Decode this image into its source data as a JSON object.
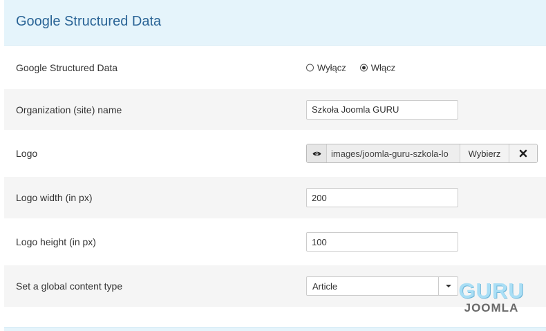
{
  "panel": {
    "title": "Google Structured Data"
  },
  "rows": {
    "enable": {
      "label": "Google Structured Data",
      "options": [
        "Wyłącz",
        "Włącz"
      ],
      "selected": "Włącz"
    },
    "org_name": {
      "label": "Organization (site) name",
      "value": "Szkoła Joomla GURU"
    },
    "logo": {
      "label": "Logo",
      "preview_icon": "eye-icon",
      "path": "images/joomla-guru-szkola-lo",
      "select_label": "Wybierz",
      "clear_icon": "close-icon"
    },
    "logo_width": {
      "label": "Logo width (in px)",
      "value": "200"
    },
    "logo_height": {
      "label": "Logo height (in px)",
      "value": "100"
    },
    "content_type": {
      "label": "Set a global content type",
      "value": "Article"
    }
  },
  "watermark": {
    "top": "GURU",
    "bottom": "JOOMLA"
  },
  "colors": {
    "header_bg": "#e5f4fb",
    "title": "#2a6496",
    "row_shade": "#f5f5f5"
  }
}
